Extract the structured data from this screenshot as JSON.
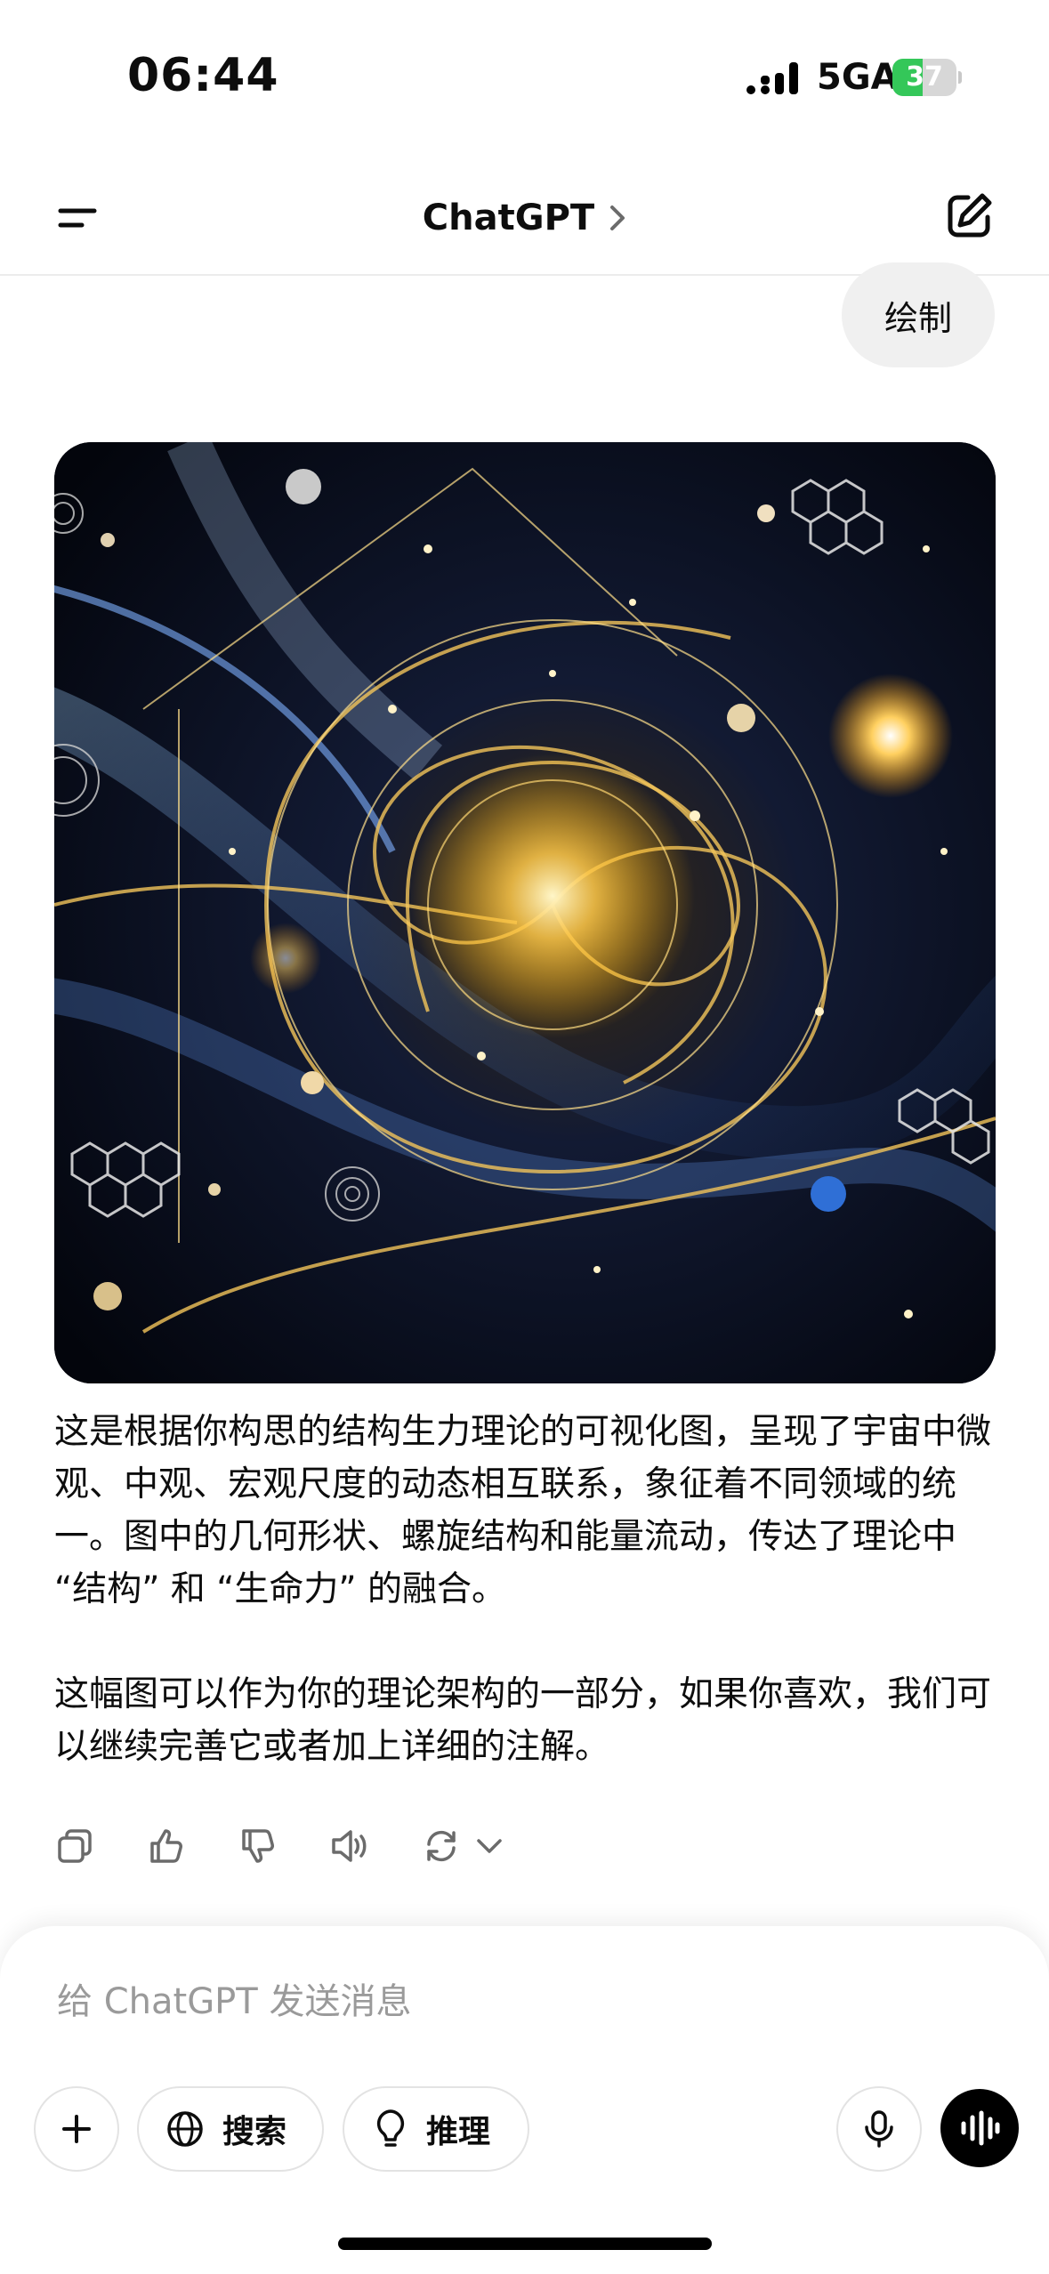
{
  "status_bar": {
    "time": "06:44",
    "network": "5GA",
    "battery_percent": "37"
  },
  "header": {
    "title": "ChatGPT"
  },
  "conversation": {
    "user_message": "绘制",
    "image_name": "structural-vitality-visualization",
    "answer_paragraphs": [
      "这是根据你构思的结构生力理论的可视化图，呈现了宇宙中微观、中观、宏观尺度的动态相互联系，象征着不同领域的统一。图中的几何形状、螺旋结构和能量流动，传达了理论中 “结构” 和 “生命力” 的融合。",
      "这幅图可以作为你的理论架构的一部分，如果你喜欢，我们可以继续完善它或者加上详细的注解。"
    ],
    "actions": [
      "copy-icon",
      "thumbs-up-icon",
      "thumbs-down-icon",
      "read-aloud-icon",
      "regenerate-icon",
      "chevron-down-icon"
    ]
  },
  "composer": {
    "placeholder": "给 ChatGPT 发送消息",
    "search_label": "搜索",
    "reason_label": "推理"
  },
  "colors": {
    "battery_green": "#34c759",
    "bubble_gray": "#f0f0f0",
    "text": "#0d0d0d",
    "placeholder": "#9a9a9a"
  }
}
